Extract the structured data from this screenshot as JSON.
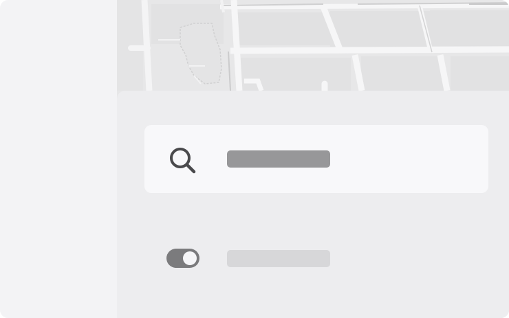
{
  "colors": {
    "sidebar_bg": "#f3f3f5",
    "map_bg": "#e9e9ea",
    "panel_bg": "#ededef",
    "search_box_bg": "#f8f8fa",
    "search_placeholder_bar": "#979799",
    "toggle_track": "#7b7b7d",
    "toggle_knob": "#f6f6f8",
    "toggle_label_bar": "#d7d7d9"
  },
  "icons": {
    "search": "search-icon"
  },
  "search": {
    "placeholder_text": ""
  },
  "toggle": {
    "label": "",
    "state": "on"
  }
}
